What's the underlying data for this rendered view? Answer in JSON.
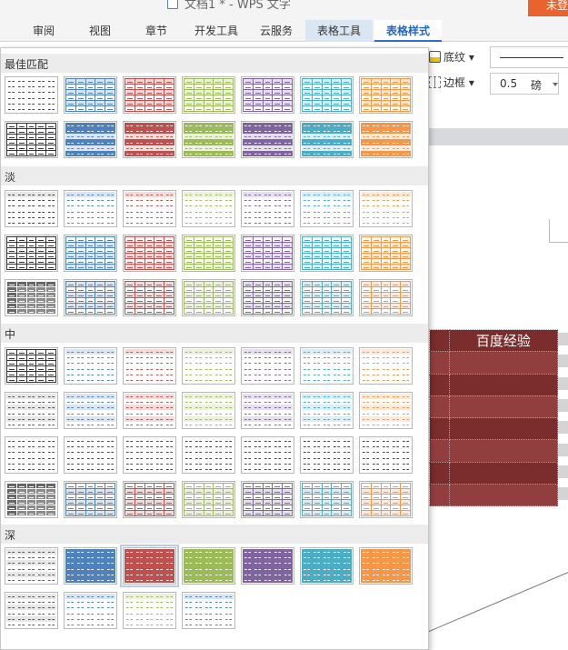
{
  "title": "文档1 * - WPS 文字",
  "login_label": "未登录",
  "tabs": [
    {
      "label": "审阅"
    },
    {
      "label": "视图"
    },
    {
      "label": "章节"
    },
    {
      "label": "开发工具"
    },
    {
      "label": "云服务"
    },
    {
      "label": "表格工具"
    },
    {
      "label": "表格样式"
    }
  ],
  "ribbon": {
    "shading_label": "底纹",
    "border_label": "边框",
    "line_weight": "0.5",
    "line_unit": "磅"
  },
  "gallery": {
    "sections": [
      {
        "name": "最佳匹配"
      },
      {
        "name": "淡"
      },
      {
        "name": "中"
      },
      {
        "name": "深"
      }
    ]
  },
  "document": {
    "table_header": "百度经验"
  },
  "colors": {
    "accent_blue": "#2e6fd1",
    "login_orange": "#e8632d",
    "doc_table_dark": "#7b2c2c",
    "doc_table_mid": "#933e3e",
    "palette": [
      "#3a3a3a",
      "#4f81bd",
      "#c0504d",
      "#9bbb59",
      "#8064a2",
      "#4bacc6",
      "#f79646"
    ],
    "palette_light": [
      "#e7e7e7",
      "#dbe5f1",
      "#f2dcdb",
      "#ebf1dd",
      "#e5e0ec",
      "#dbeef3",
      "#fdeada"
    ]
  }
}
